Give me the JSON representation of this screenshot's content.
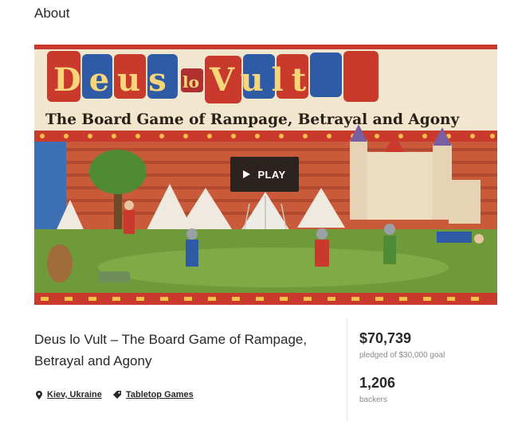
{
  "section": {
    "title": "About"
  },
  "video": {
    "play_label": "PLAY",
    "art_title_left": "Deus",
    "art_title_mid": "lo",
    "art_title_right": "Vult",
    "art_subtitle": "The Board Game of Rampage, Betrayal and Agony"
  },
  "project": {
    "title": "Deus lo Vult – The Board Game of Rampage, Betrayal and Agony",
    "location": "Kiev, Ukraine",
    "category": "Tabletop Games"
  },
  "stats": {
    "pledged": "$70,739",
    "pledged_label": "pledged of $30,000 goal",
    "backers": "1,206",
    "backers_label": "backers"
  },
  "icons": {
    "location": "pin-icon",
    "category": "tag-icon",
    "play": "play-icon"
  },
  "colors": {
    "art_red": "#c9392c",
    "art_blue": "#2f5aa6",
    "art_grass": "#6e9a3a",
    "text": "#282828",
    "muted": "#8a8a8a"
  }
}
